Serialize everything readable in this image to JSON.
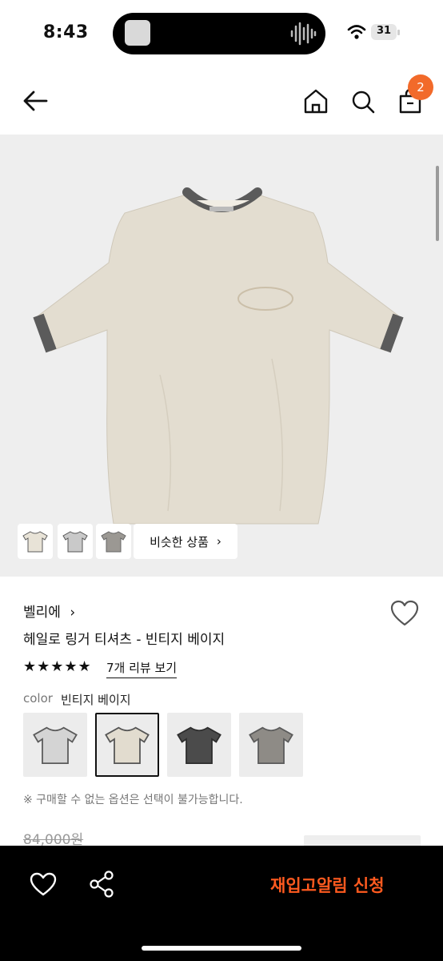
{
  "status_bar": {
    "time": "8:43",
    "battery": "31"
  },
  "nav": {
    "cart_count": "2",
    "icons": [
      "back-arrow-icon",
      "home-icon",
      "search-icon",
      "cart-icon"
    ]
  },
  "gallery": {
    "similar_button_label": "비슷한 상품",
    "thumbnails": [
      "beige-tshirt-thumb",
      "gray-tshirt-thumb",
      "gray-tshirt-thumb-alt"
    ]
  },
  "product": {
    "brand": "벨리에",
    "name": "헤일로 링거 티셔츠 - 빈티지 베이지",
    "rating_stars": 5,
    "stars_text": "★★★★★",
    "review_link": "7개 리뷰 보기",
    "color_label": "color",
    "color_value": "빈티지 베이지",
    "swatches": [
      {
        "body": "#d4d4d4",
        "trim": "#5a5a5a",
        "selected": false
      },
      {
        "body": "#e2dccf",
        "trim": "#555555",
        "selected": true
      },
      {
        "body": "#4b4b4b",
        "trim": "#2e2e2e",
        "selected": false
      },
      {
        "body": "#8e8b86",
        "trim": "#5b5b5b",
        "selected": false
      }
    ],
    "notice": "※ 구매할 수 없는 옵션은 선택이 불가능합니다.",
    "price_original": "84,000원"
  },
  "bottom_bar": {
    "restock_label": "재입고알림 신청"
  },
  "colors": {
    "accent": "#f26a2a",
    "restock": "#ff5a1f",
    "shirt_body": "#e3ddd0",
    "shirt_trim": "#5b5b5b"
  }
}
